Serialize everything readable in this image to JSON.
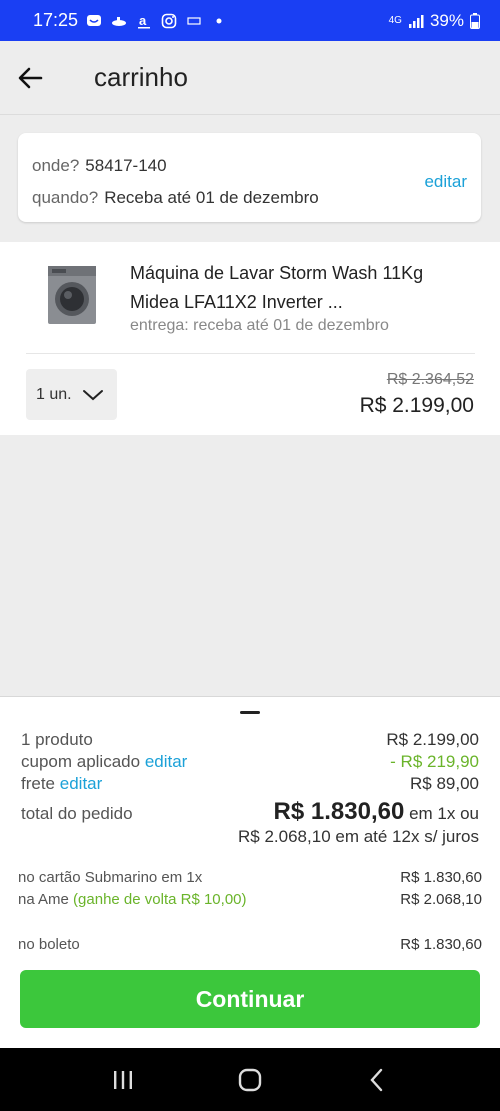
{
  "status_bar": {
    "time": "17:25",
    "battery": "39%",
    "network": "4G"
  },
  "header": {
    "title": "carrinho"
  },
  "address": {
    "where_label": "onde?",
    "where_value": "58417-140",
    "when_label": "quando?",
    "when_value": "Receba até 01 de dezembro",
    "edit_label": "editar"
  },
  "product": {
    "name": "Máquina de Lavar Storm Wash 11Kg Midea LFA11X2 Inverter ...",
    "delivery": "entrega: receba até 01 de dezembro",
    "quantity": "1 un.",
    "old_price": "R$ 2.364,52",
    "price": "R$ 2.199,00"
  },
  "summary": {
    "products_label": "1 produto",
    "products_value": "R$ 2.199,00",
    "coupon_label": "cupom aplicado",
    "coupon_edit": "editar",
    "coupon_value": "- R$ 219,90",
    "shipping_label": "frete",
    "shipping_edit": "editar",
    "shipping_value": "R$ 89,00",
    "total_label": "total do pedido",
    "total_value": "R$ 1.830,60",
    "total_suffix": "em 1x ou",
    "installments": "R$ 2.068,10 em até 12x s/ juros"
  },
  "payments": [
    {
      "label": "no cartão Submarino em 1x",
      "extra": "",
      "value": "R$ 1.830,60"
    },
    {
      "label": "na Ame",
      "extra": "(ganhe de volta R$ 10,00)",
      "value": "R$ 2.068,10"
    },
    {
      "label": "no boleto",
      "extra": "",
      "value": "R$ 1.830,60"
    }
  ],
  "continue_button": "Continuar",
  "colors": {
    "status_bar": "#1a3ff3",
    "link": "#1ba1d8",
    "green": "#3cc73c",
    "cashback": "#6ab42a"
  }
}
